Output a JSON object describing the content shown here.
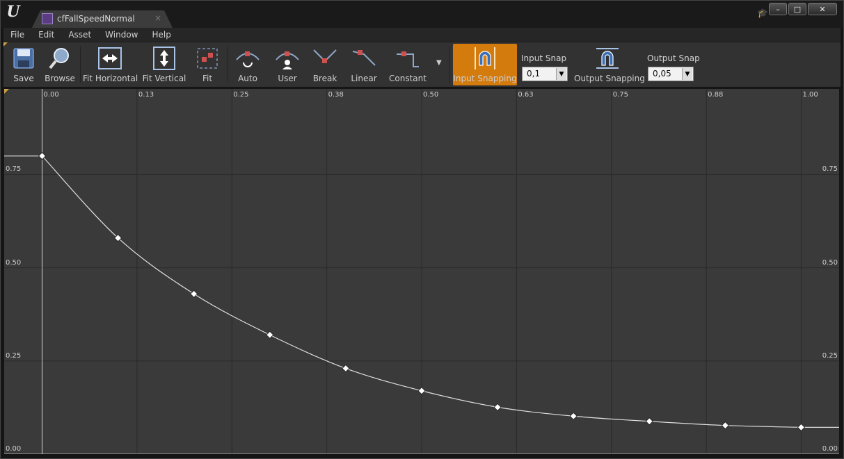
{
  "window": {
    "tab_title": "cfFallSpeedNormal",
    "tab_close": "×",
    "logo": "U",
    "controls": {
      "minimize": "–",
      "maximize": "□",
      "close": "✕"
    }
  },
  "menu": [
    "File",
    "Edit",
    "Asset",
    "Window",
    "Help"
  ],
  "toolbar": {
    "save": "Save",
    "browse": "Browse",
    "fit_horizontal": "Fit Horizontal",
    "fit_vertical": "Fit Vertical",
    "fit": "Fit",
    "auto": "Auto",
    "user": "User",
    "break": "Break",
    "linear": "Linear",
    "constant": "Constant",
    "input_snapping": "Input Snapping",
    "input_snap_label": "Input Snap",
    "input_snap_value": "0,1",
    "output_snapping": "Output Snapping",
    "output_snap_label": "Output Snap",
    "output_snap_value": "0,05"
  },
  "colors": {
    "accent": "#d47b0e",
    "graph_bg": "#3a3a3a",
    "curve": "#e0e0e0"
  },
  "chart_data": {
    "type": "line",
    "x_tick_labels": [
      "0.00",
      "0.13",
      "0.25",
      "0.38",
      "0.50",
      "0.63",
      "0.75",
      "0.88",
      "1.00"
    ],
    "y_tick_labels": [
      "0.75",
      "0.50",
      "0.25",
      "0.00"
    ],
    "keys": [
      {
        "x": 0.0,
        "y": 0.8
      },
      {
        "x": 0.1,
        "y": 0.58
      },
      {
        "x": 0.2,
        "y": 0.43
      },
      {
        "x": 0.3,
        "y": 0.32
      },
      {
        "x": 0.4,
        "y": 0.23
      },
      {
        "x": 0.5,
        "y": 0.17
      },
      {
        "x": 0.6,
        "y": 0.126
      },
      {
        "x": 0.7,
        "y": 0.102
      },
      {
        "x": 0.8,
        "y": 0.088
      },
      {
        "x": 0.9,
        "y": 0.077
      },
      {
        "x": 1.0,
        "y": 0.072
      }
    ],
    "xlim": [
      -0.05,
      1.05
    ],
    "ylim": [
      0.0,
      0.98
    ],
    "grid": true
  }
}
